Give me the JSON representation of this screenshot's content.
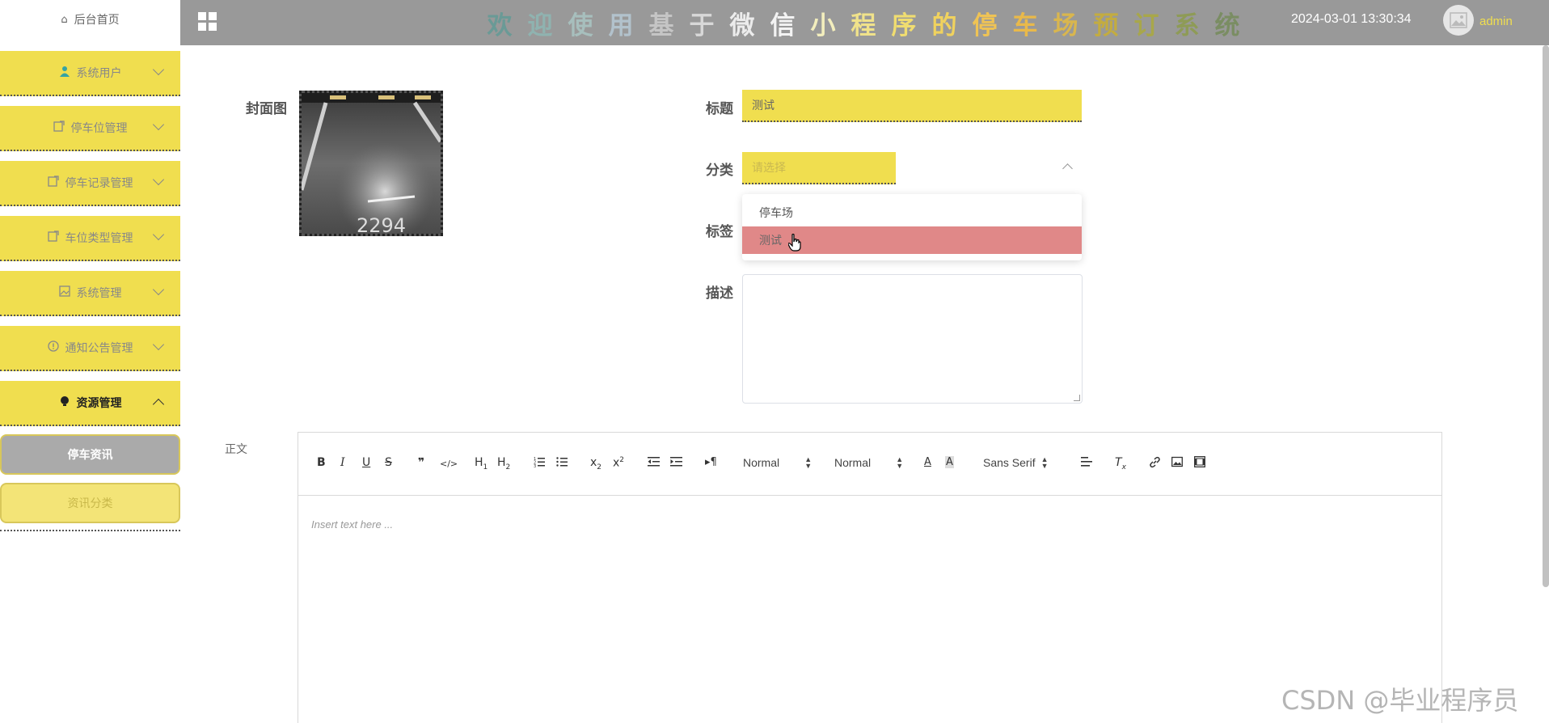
{
  "header": {
    "welcome_chars": [
      {
        "ch": "欢",
        "color": "#6a9a96"
      },
      {
        "ch": "迎",
        "color": "#8fb3b0"
      },
      {
        "ch": "使",
        "color": "#a7bfbd"
      },
      {
        "ch": "用",
        "color": "#b2c2cc"
      },
      {
        "ch": "基",
        "color": "#c5c5c5"
      },
      {
        "ch": "于",
        "color": "#d8d8d8"
      },
      {
        "ch": "微",
        "color": "#ececec"
      },
      {
        "ch": "信",
        "color": "#f3f3f3"
      },
      {
        "ch": "小",
        "color": "#f3eebd"
      },
      {
        "ch": "程",
        "color": "#f0e28a"
      },
      {
        "ch": "序",
        "color": "#f0dd70"
      },
      {
        "ch": "的",
        "color": "#f0d25e"
      },
      {
        "ch": "停",
        "color": "#efc354"
      },
      {
        "ch": "车",
        "color": "#e9b94a"
      },
      {
        "ch": "场",
        "color": "#d9b64e"
      },
      {
        "ch": "预",
        "color": "#c3ac40"
      },
      {
        "ch": "订",
        "color": "#a8a74a"
      },
      {
        "ch": "系",
        "color": "#8e9b56"
      },
      {
        "ch": "统",
        "color": "#7a8d63"
      }
    ],
    "datetime": "2024-03-01 13:30:34",
    "username": "admin"
  },
  "sidebar": {
    "home": "后台首页",
    "items": [
      {
        "label": "系统用户",
        "icon": "user-icon"
      },
      {
        "label": "停车位管理",
        "icon": "edit-icon"
      },
      {
        "label": "停车记录管理",
        "icon": "edit-icon"
      },
      {
        "label": "车位类型管理",
        "icon": "edit-icon"
      },
      {
        "label": "系统管理",
        "icon": "image-icon"
      },
      {
        "label": "通知公告管理",
        "icon": "info-icon"
      },
      {
        "label": "资源管理",
        "icon": "bulb-icon"
      }
    ],
    "sub_items": [
      {
        "label": "停车资讯"
      },
      {
        "label": "资讯分类"
      }
    ]
  },
  "form": {
    "cover_label": "封面图",
    "title_label": "标题",
    "title_value": "测试",
    "category_label": "分类",
    "category_placeholder": "请选择",
    "tags_label": "标签",
    "description_label": "描述",
    "body_label": "正文",
    "dropdown_options": [
      "停车场",
      "测试"
    ]
  },
  "editor": {
    "header_select": "Normal",
    "size_select": "Normal",
    "font_select": "Sans Serif",
    "placeholder": "Insert text here ..."
  },
  "watermark": "CSDN @毕业程序员",
  "colors": {
    "accent": "#f0de4f",
    "header_bg": "#999999",
    "option_hover": "#e08888"
  }
}
